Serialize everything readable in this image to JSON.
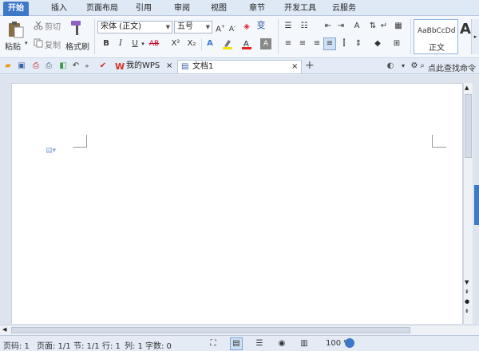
{
  "menu": {
    "tabs": [
      "开始",
      "插入",
      "页面布局",
      "引用",
      "审阅",
      "视图",
      "章节",
      "开发工具",
      "云服务"
    ],
    "active_index": 0
  },
  "ribbon": {
    "paste_label": "粘贴",
    "cut_label": "剪切",
    "copy_label": "复制",
    "format_painter_label": "格式刷",
    "font_name": "宋体 (正文)",
    "font_size": "五号",
    "style_preview": "AaBbCcDd",
    "style_name": "正文",
    "style_big": "A",
    "bold": "B",
    "italic": "I",
    "underline": "U",
    "strike": "AB",
    "superscript": "X²",
    "subscript": "X₂",
    "char_spacing": "变"
  },
  "quickbar": {
    "search_label": "点此查找命令",
    "tabs": [
      {
        "label": "我的WPS",
        "active": false
      },
      {
        "label": "文档1",
        "active": true
      }
    ],
    "new_tab": "+"
  },
  "status": {
    "page_code": "页码: 1",
    "pages": "页面: 1/1",
    "section": "节: 1/1",
    "row": "行: 1",
    "col": "列: 1",
    "words": "字数: 0",
    "zoom": "100 %"
  },
  "colors": {
    "accent": "#3d78c9",
    "wps_red": "#d93025",
    "page_bg": "#ffffff",
    "ribbon_bg": "#f4f7fb"
  }
}
